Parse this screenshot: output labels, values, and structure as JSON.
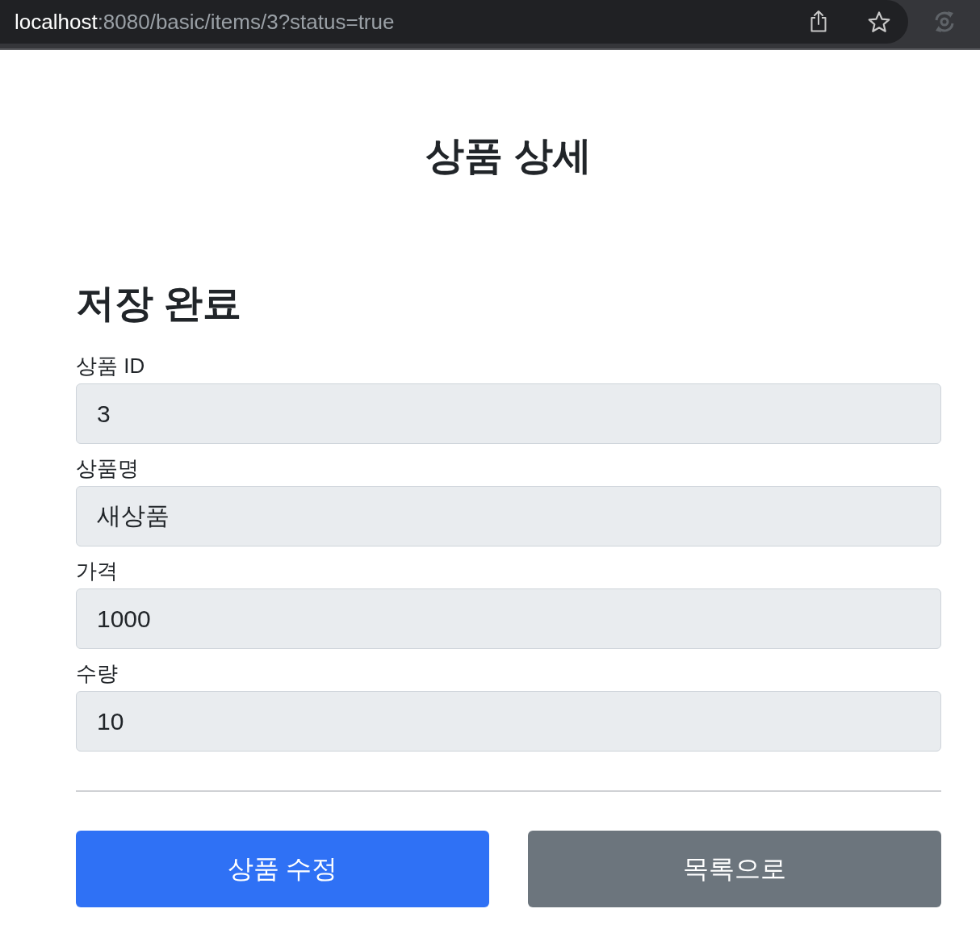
{
  "browser": {
    "url_host": "localhost",
    "url_path": ":8080/basic/items/3?status=true"
  },
  "page": {
    "title": "상품 상세",
    "message": "저장 완료"
  },
  "fields": [
    {
      "label": "상품 ID",
      "value": "3",
      "readonly": true
    },
    {
      "label": "상품명",
      "value": "새상품",
      "readonly": true
    },
    {
      "label": "가격",
      "value": "1000",
      "readonly": true
    },
    {
      "label": "수량",
      "value": "10",
      "readonly": true
    }
  ],
  "buttons": [
    {
      "label": "상품 수정",
      "kind": "primary"
    },
    {
      "label": "목록으로",
      "kind": "secondary"
    }
  ]
}
